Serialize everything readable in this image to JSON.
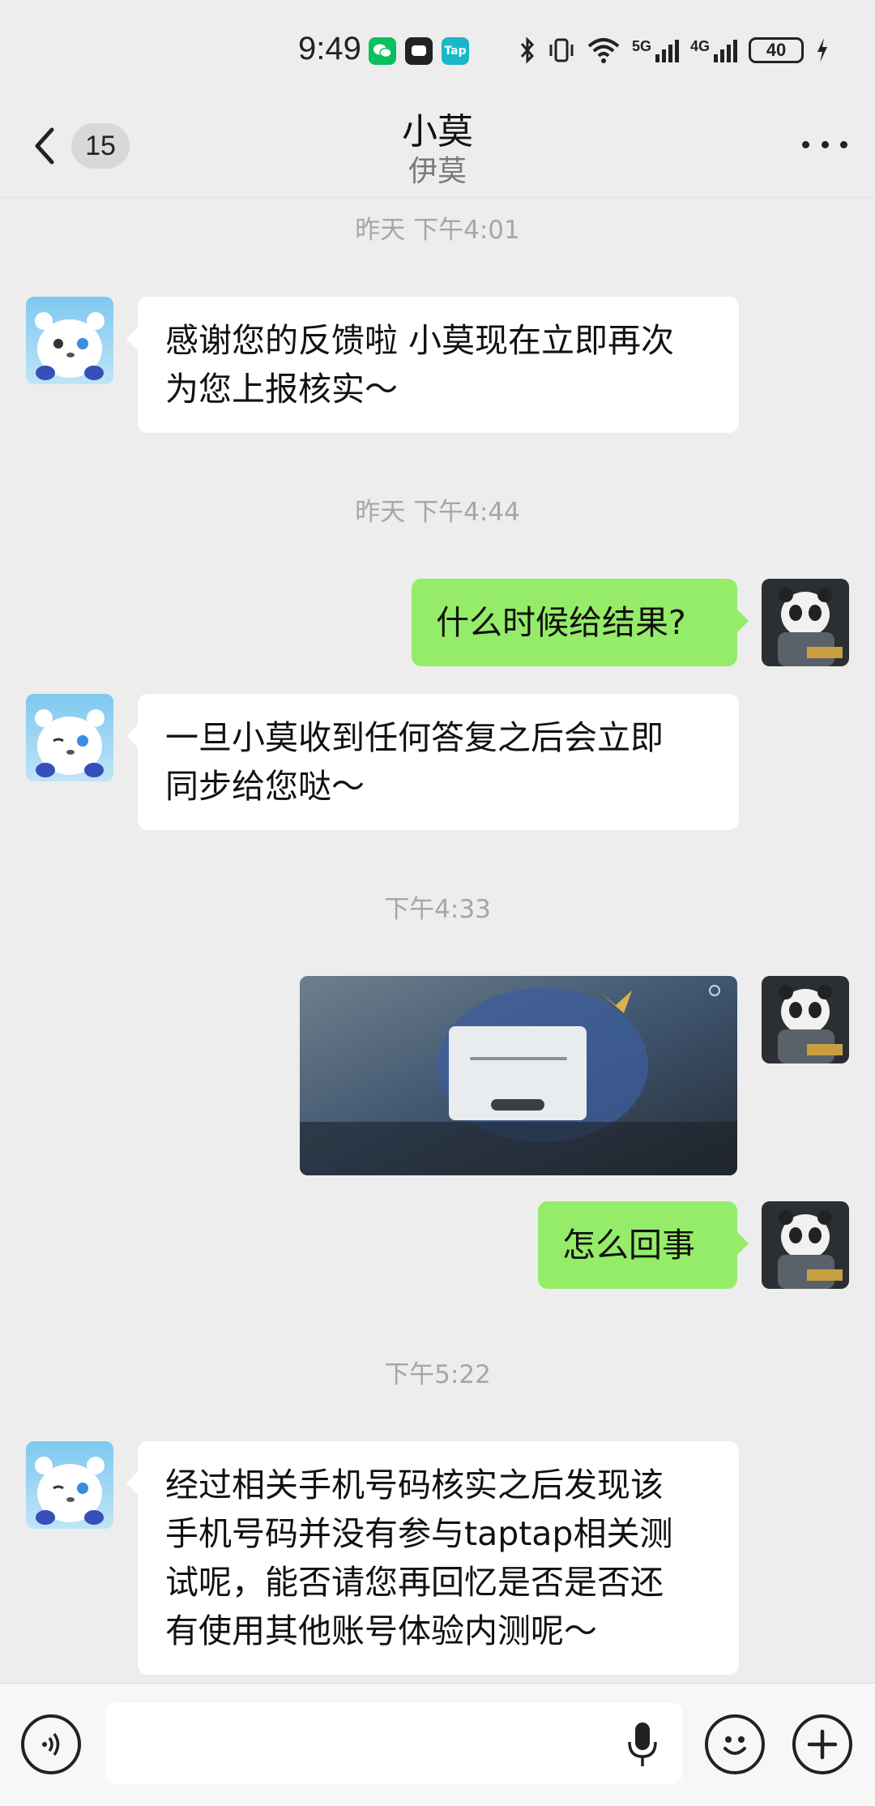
{
  "status_bar": {
    "time": "9:49",
    "tap_label": "Tap",
    "network_5g": "5G",
    "network_4g": "4G",
    "battery": "40"
  },
  "header": {
    "unread_count": "15",
    "title": "小莫",
    "subtitle": "伊莫"
  },
  "messages": [
    {
      "type": "timestamp",
      "text": "昨天 下午4:01"
    },
    {
      "type": "incoming",
      "lines": [
        "感谢您的反馈啦 小莫现在立即再次",
        "为您上报核实～"
      ]
    },
    {
      "type": "timestamp",
      "text": "昨天 下午4:44"
    },
    {
      "type": "outgoing",
      "lines": [
        "什么时候给结果?"
      ]
    },
    {
      "type": "incoming",
      "lines": [
        "一旦小莫收到任何答复之后会立即",
        "同步给您哒～"
      ]
    },
    {
      "type": "timestamp",
      "text": "下午4:33"
    },
    {
      "type": "outgoing_image",
      "image_text": ""
    },
    {
      "type": "outgoing",
      "lines": [
        "怎么回事"
      ]
    },
    {
      "type": "timestamp",
      "text": "下午5:22"
    },
    {
      "type": "incoming",
      "lines": [
        "经过相关手机号码核实之后发现该",
        "手机号码并没有参与taptap相关测",
        "试呢，能否请您再回忆是否是否还",
        "有使用其他账号体验内测呢～"
      ]
    }
  ],
  "input_bar": {
    "placeholder": "",
    "value": ""
  },
  "colors": {
    "background": "#ededed",
    "outgoing_bubble": "#95ec69",
    "incoming_bubble": "#ffffff",
    "timestamp": "#a6a6a6"
  },
  "icons": [
    "bluetooth-icon",
    "vibrate-icon",
    "wifi-icon",
    "signal-icon",
    "battery-icon",
    "charging-icon",
    "back-arrow-icon",
    "more-icon",
    "voice-icon",
    "mic-icon",
    "emoji-icon",
    "plus-icon"
  ]
}
